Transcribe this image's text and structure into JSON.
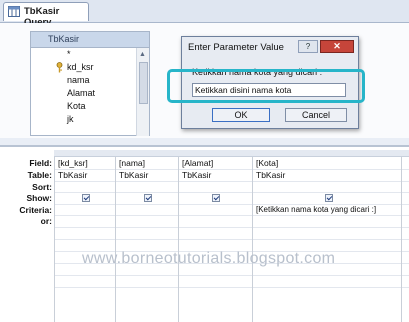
{
  "window": {
    "tab_title": "TbKasir Query"
  },
  "table_box": {
    "name": "TbKasir",
    "star": "*",
    "fields": [
      "kd_ksr",
      "nama",
      "Alamat",
      "Kota",
      "jk"
    ]
  },
  "dialog": {
    "title": "Enter Parameter Value",
    "help_label": "?",
    "close_label": "✕",
    "prompt": "Ketikkan nama kota yang dicari :",
    "input_value": "Ketikkan disini nama kota",
    "ok_label": "OK",
    "cancel_label": "Cancel",
    "highlight_color": "#27b5c9"
  },
  "grid": {
    "row_labels": [
      "Field:",
      "Table:",
      "Sort:",
      "Show:",
      "Criteria:",
      "or:"
    ],
    "columns": [
      {
        "field": "[kd_ksr]",
        "table": "TbKasir",
        "show": true,
        "criteria": ""
      },
      {
        "field": "[nama]",
        "table": "TbKasir",
        "show": true,
        "criteria": ""
      },
      {
        "field": "[Alamat]",
        "table": "TbKasir",
        "show": true,
        "criteria": ""
      },
      {
        "field": "[Kota]",
        "table": "TbKasir",
        "show": true,
        "criteria": "[Ketikkan nama kota yang dicari :]"
      }
    ]
  },
  "watermark": "www.borneotutorials.blogspot.com"
}
